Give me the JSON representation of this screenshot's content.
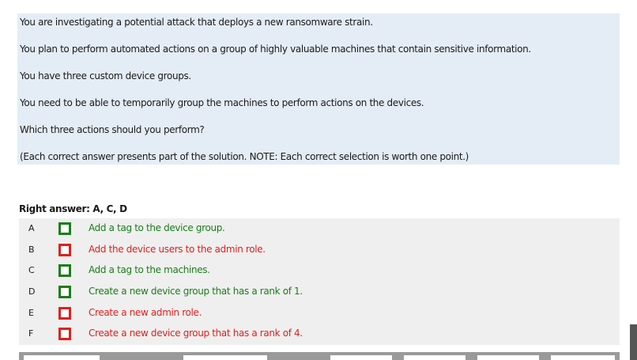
{
  "question": {
    "lines": [
      "You are investigating a potential attack that deploys a new ransomware strain.",
      "You plan to perform automated actions on a group of highly valuable machines that contain sensitive information.",
      "You have three custom device groups.",
      "You need to be able to temporarily group the machines to perform actions on the devices.",
      "Which three actions should you perform?",
      "(Each correct answer presents part of the solution. NOTE: Each correct selection is worth one point.)"
    ]
  },
  "answer": {
    "heading": "Right answer: A, C, D"
  },
  "options": [
    {
      "letter": "A",
      "text": "Add a tag to the device group.",
      "correct": true
    },
    {
      "letter": "B",
      "text": "Add the device users to the admin role.",
      "correct": false
    },
    {
      "letter": "C",
      "text": "Add a tag to the machines.",
      "correct": true
    },
    {
      "letter": "D",
      "text": "Create a new device group that has a rank of 1.",
      "correct": true
    },
    {
      "letter": "E",
      "text": "Create a new admin role.",
      "correct": false
    },
    {
      "letter": "F",
      "text": "Create a new device group that has a rank of 4.",
      "correct": false
    }
  ],
  "colors": {
    "correct": "#1a7f1a",
    "wrong": "#e0201e",
    "question_bg": "#e4edf6",
    "options_bg": "#efefef"
  }
}
